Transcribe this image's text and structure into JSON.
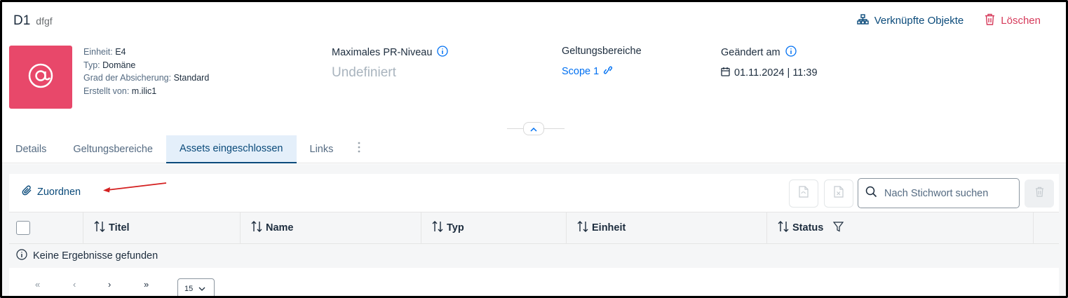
{
  "header": {
    "title": "D1",
    "subtitle": "dfgf",
    "actions": {
      "linked_objects": "Verknüpfte Objekte",
      "delete": "Löschen"
    }
  },
  "avatar": {
    "icon": "at-sign-icon",
    "color": "#e8486a"
  },
  "meta": {
    "unit_label": "Einheit:",
    "unit_value": "E4",
    "type_label": "Typ:",
    "type_value": "Domäne",
    "assurance_label": "Grad der Absicherung:",
    "assurance_value": "Standard",
    "created_label": "Erstellt von:",
    "created_value": "m.ilic1"
  },
  "kpis": {
    "pr_level_label": "Maximales PR-Niveau",
    "pr_level_value": "Undefiniert",
    "scopes_label": "Geltungsbereiche",
    "scopes_link": "Scope 1",
    "changed_label": "Geändert am",
    "changed_value": "01.11.2024 | 11:39"
  },
  "tabs": [
    {
      "label": "Details",
      "active": false
    },
    {
      "label": "Geltungsbereiche",
      "active": false
    },
    {
      "label": "Assets eingeschlossen",
      "active": true
    },
    {
      "label": "Links",
      "active": false
    }
  ],
  "toolbar": {
    "assign_label": "Zuordnen",
    "search_placeholder": "Nach Stichwort suchen"
  },
  "table": {
    "columns": [
      "Titel",
      "Name",
      "Typ",
      "Einheit",
      "Status"
    ],
    "empty_message": "Keine Ergebnisse gefunden"
  },
  "pagination": {
    "first": "«",
    "prev": "‹",
    "next": "›",
    "last": "»",
    "page_size": "15"
  },
  "colors": {
    "accent": "#0a4a7a",
    "danger": "#d63a5a",
    "link": "#0070f2",
    "annotation_arrow": "#d42020"
  }
}
